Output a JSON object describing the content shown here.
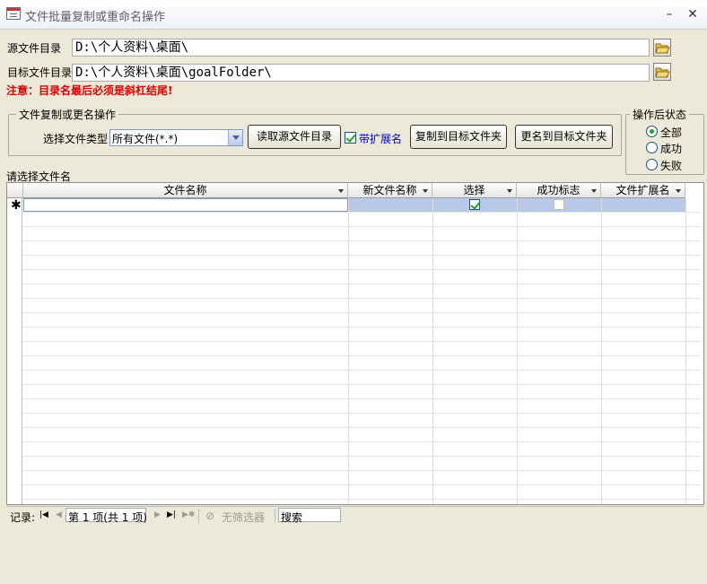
{
  "window": {
    "title": "文件批量复制或重命名操作",
    "min_glyph": "–",
    "close_glyph": "✕"
  },
  "source": {
    "label": "源文件目录",
    "value": "D:\\个人资料\\桌面\\"
  },
  "target": {
    "label": "目标文件目录",
    "value": "D:\\个人资料\\桌面\\goalFolder\\"
  },
  "warning": "注意：目录名最后必须是斜杠结尾!",
  "ops": {
    "legend": "文件复制或更名操作",
    "file_type_label": "选择文件类型",
    "file_type_value": "所有文件(*.*)",
    "read_button": "读取源文件目录",
    "with_ext_label": "带扩展名",
    "with_ext_checked": true,
    "copy_button": "复制到目标文件夹",
    "rename_button": "更名到目标文件夹"
  },
  "status": {
    "legend": "操作后状态",
    "options": [
      "全部",
      "成功",
      "失败"
    ],
    "selected": "全部"
  },
  "grid_label": "请选择文件名",
  "grid": {
    "columns": [
      "文件名称",
      "新文件名称",
      "选择",
      "成功标志",
      "文件扩展名"
    ],
    "new_row_marker": "✱",
    "new_row": {
      "选择": true,
      "成功标志": false
    }
  },
  "navigator": {
    "record_label": "记录:",
    "position": "第 1 项(共 1 项)",
    "filter_label": "无筛选器",
    "search_placeholder": "搜索"
  },
  "colors": {
    "warning": "#e00000",
    "window_bg": "#ece9d8",
    "new_row_bg": "#b9cae9",
    "check": "#21a121",
    "with_ext_label": "#0000cc"
  }
}
